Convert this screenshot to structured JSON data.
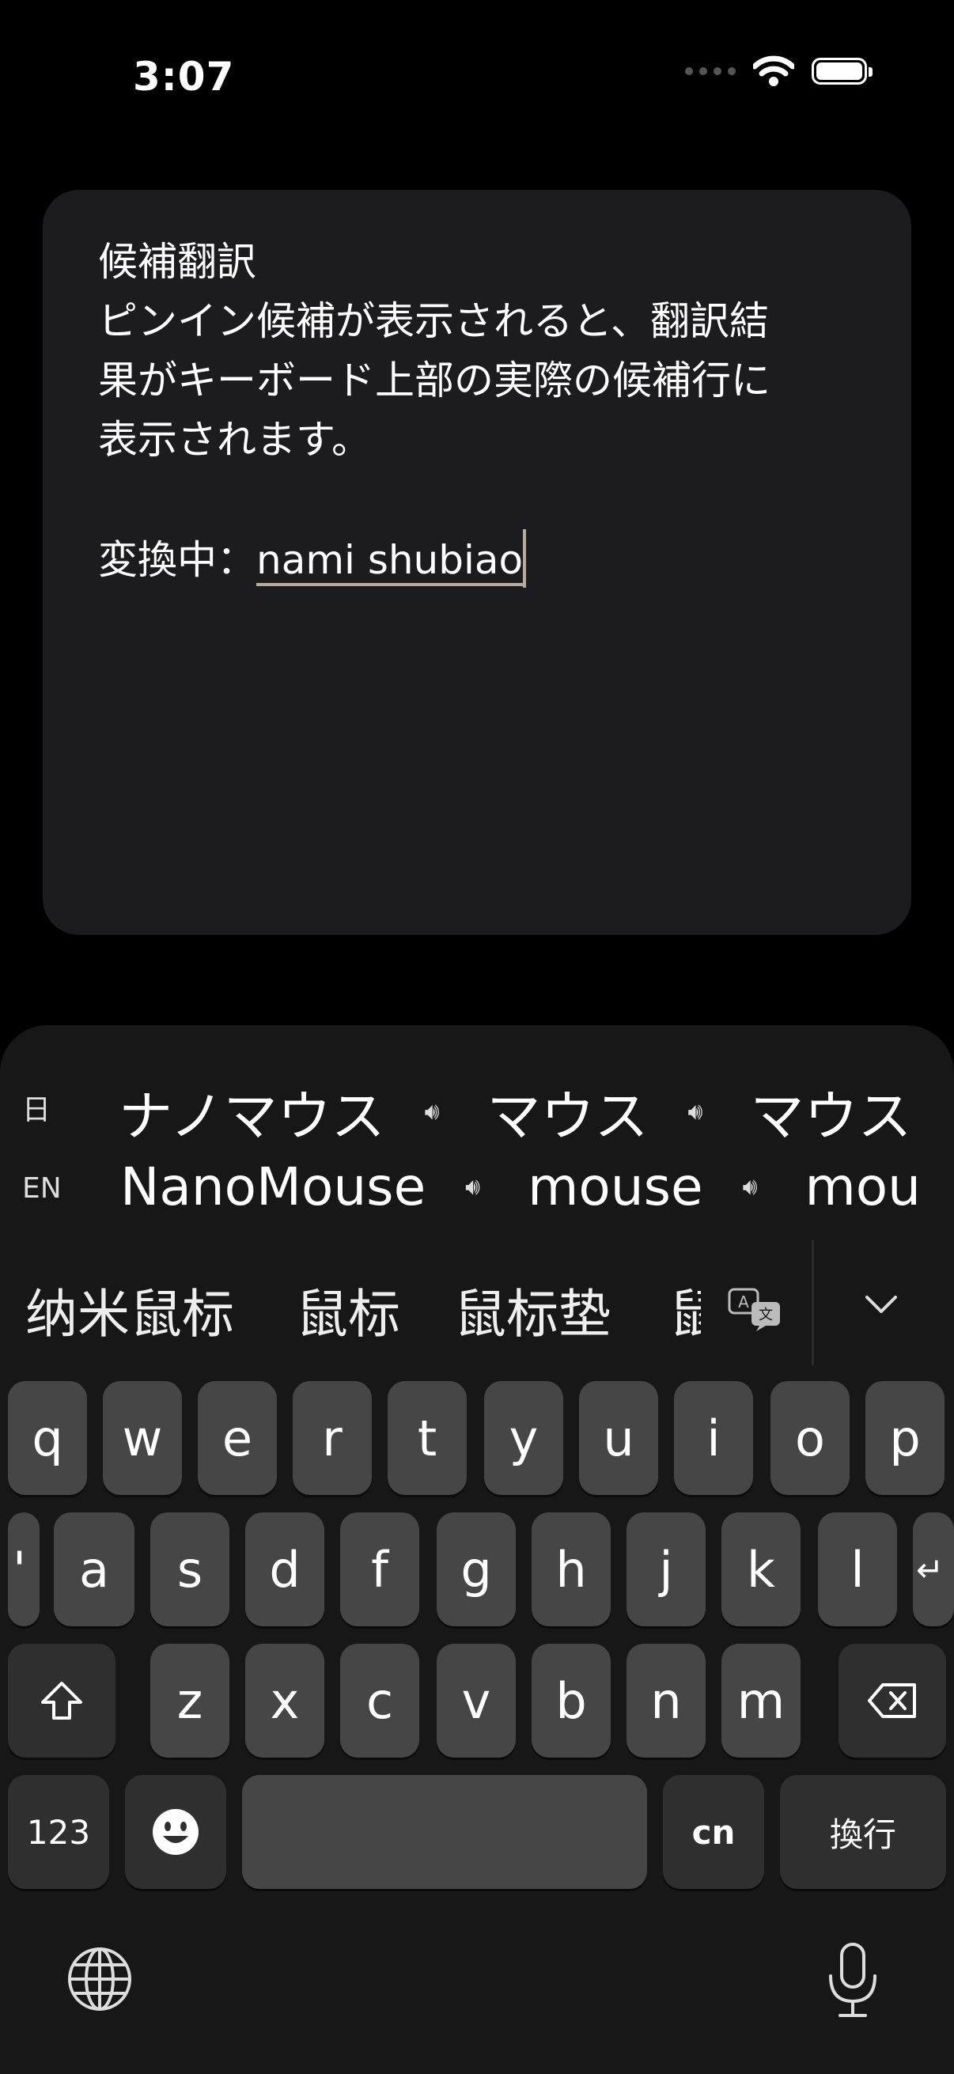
{
  "status": {
    "time": "3:07"
  },
  "note": {
    "line1": "候補翻訳",
    "line2": "ピンイン候補が表示されると、翻訳結",
    "line3": "果がキーボード上部の実際の候補行に",
    "line4": "表示されます。",
    "composing_label": "変換中：",
    "composing_text": "nami shubiao"
  },
  "translations": {
    "jp_tag": "日",
    "en_tag": "EN",
    "jp": [
      "ナノマウス",
      "マウス",
      "マウス"
    ],
    "en": [
      "NanoMouse",
      "mouse",
      "mou"
    ]
  },
  "candidates": [
    "纳米鼠标",
    "鼠标",
    "鼠标垫",
    "鼠"
  ],
  "keys": {
    "row1": [
      "q",
      "w",
      "e",
      "r",
      "t",
      "y",
      "u",
      "i",
      "o",
      "p"
    ],
    "row2": [
      "'",
      "a",
      "s",
      "d",
      "f",
      "g",
      "h",
      "j",
      "k",
      "l",
      "↵"
    ],
    "row3": [
      "z",
      "x",
      "c",
      "v",
      "b",
      "n",
      "m"
    ],
    "numbers": "123",
    "lang": "cn",
    "return": "換行",
    "space": ""
  }
}
